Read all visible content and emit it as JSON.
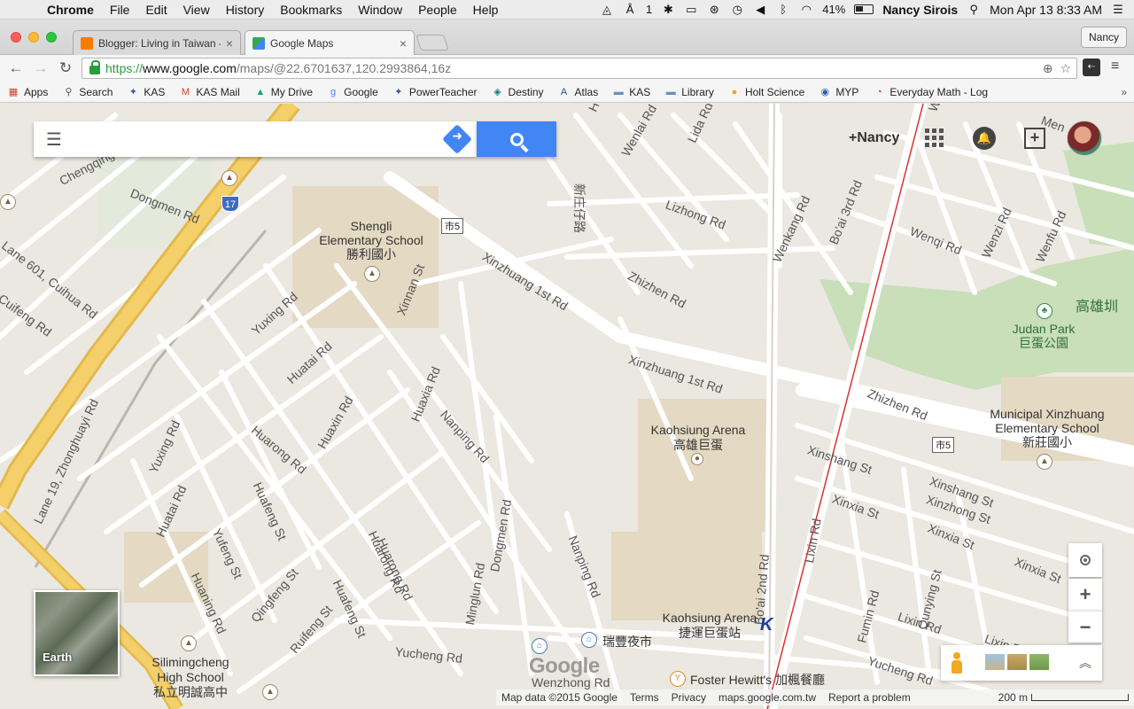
{
  "menubar": {
    "app": "Chrome",
    "items": [
      "File",
      "Edit",
      "View",
      "History",
      "Bookmarks",
      "Window",
      "People",
      "Help"
    ],
    "adobe_badge": "1",
    "battery": "41%",
    "user": "Nancy Sirois",
    "clock": "Mon Apr 13  8:33 AM"
  },
  "tabs": [
    {
      "title": "Blogger: Living in Taiwan -",
      "favicon_color": "#f57d00"
    },
    {
      "title": "Google Maps",
      "favicon_color": "#34a853"
    }
  ],
  "profile": "Nancy",
  "address": {
    "scheme": "https://",
    "host": "www.google.com",
    "path": "/maps/@22.6701637,120.2993864,16z"
  },
  "bookmarks": [
    {
      "label": "Apps",
      "icon": "apps-grid-icon",
      "glyph": "▦",
      "color": "#d23f31"
    },
    {
      "label": "Search",
      "icon": "search-icon",
      "glyph": "⚲",
      "color": "#555"
    },
    {
      "label": "KAS",
      "icon": "kas-icon",
      "glyph": "✦",
      "color": "#3b5998"
    },
    {
      "label": "KAS Mail",
      "icon": "gmail-icon",
      "glyph": "M",
      "color": "#d23f31"
    },
    {
      "label": "My Drive",
      "icon": "drive-icon",
      "glyph": "▲",
      "color": "#1fa463"
    },
    {
      "label": "Google",
      "icon": "google-icon",
      "glyph": "g",
      "color": "#4285f4"
    },
    {
      "label": "PowerTeacher",
      "icon": "powerteacher-icon",
      "glyph": "✦",
      "color": "#3b5998"
    },
    {
      "label": "Destiny",
      "icon": "destiny-icon",
      "glyph": "◈",
      "color": "#0a7e6e"
    },
    {
      "label": "Atlas",
      "icon": "atlas-icon",
      "glyph": "A",
      "color": "#2b4c7e"
    },
    {
      "label": "KAS",
      "icon": "folder-icon",
      "glyph": "▬",
      "color": "#6a8fbf"
    },
    {
      "label": "Library",
      "icon": "folder-icon",
      "glyph": "▬",
      "color": "#6a8fbf"
    },
    {
      "label": "Holt Science",
      "icon": "holt-icon",
      "glyph": "●",
      "color": "#f0a030"
    },
    {
      "label": "MYP",
      "icon": "myp-icon",
      "glyph": "◉",
      "color": "#2d5fa8"
    },
    {
      "label": "Everyday Math - Log",
      "icon": "everyday-math-icon",
      "glyph": "◔",
      "color": "#c33"
    }
  ],
  "bookmarks_more": "»",
  "search": {
    "placeholder": "",
    "value": ""
  },
  "account": {
    "name": "+Nancy"
  },
  "map": {
    "street_labels": [
      {
        "text": "Chengqing Rd"
      },
      {
        "text": "Dongmen Rd"
      },
      {
        "text": "Lane 601, Cuihua Rd"
      },
      {
        "text": "Cuifeng Rd"
      },
      {
        "text": "Yuxing Rd"
      },
      {
        "text": "Huatai Rd"
      },
      {
        "text": "Huarong Rd"
      },
      {
        "text": "Huaxin Rd"
      },
      {
        "text": "Huaxia Rd"
      },
      {
        "text": "Nanping Rd"
      },
      {
        "text": "Xinnan St"
      },
      {
        "text": "Xinzhuang 1st Rd"
      },
      {
        "text": "Xinzhuang 1st Rd"
      },
      {
        "text": "Zhizhen Rd"
      },
      {
        "text": "Lizhong Rd"
      },
      {
        "text": "Wenlai Rd"
      },
      {
        "text": "Lida Rd"
      },
      {
        "text": "Wenkang Rd"
      },
      {
        "text": "Bo'ai 3rd Rd"
      },
      {
        "text": "Wenqi Rd"
      },
      {
        "text": "Wenzi Rd"
      },
      {
        "text": "Wenfu Rd"
      },
      {
        "text": "Zhizhen Rd"
      },
      {
        "text": "Xinshang St"
      },
      {
        "text": "Xinxia St"
      },
      {
        "text": "Xinzhong St"
      },
      {
        "text": "Xinshang St"
      },
      {
        "text": "Xinxia St"
      },
      {
        "text": "Xinxia St"
      },
      {
        "text": "Lixin Rd"
      },
      {
        "text": "Bo'ai 2nd Rd"
      },
      {
        "text": "Fumin Rd"
      },
      {
        "text": "Qunying St"
      },
      {
        "text": "Lixin Rd"
      },
      {
        "text": "Lixin Rd"
      },
      {
        "text": "Yucheng Rd"
      },
      {
        "text": "Yucheng Rd"
      },
      {
        "text": "Wenzhong Rd"
      },
      {
        "text": "Minglun Rd"
      },
      {
        "text": "Dongmen Rd"
      },
      {
        "text": "Nanping Rd"
      },
      {
        "text": "Huarong Rd"
      },
      {
        "text": "Huafeng St"
      },
      {
        "text": "Huafeng St"
      },
      {
        "text": "Qingfeng St"
      },
      {
        "text": "Ruifeng St"
      },
      {
        "text": "Yufeng St"
      },
      {
        "text": "Huaning Rd"
      },
      {
        "text": "Huatai Rd"
      },
      {
        "text": "Yuxing Rd"
      },
      {
        "text": "Lane 19, Zhonghuayi Rd"
      },
      {
        "text": "Huarong Rd"
      },
      {
        "text": "新庄仔路"
      },
      {
        "text": "Hua"
      },
      {
        "text": "Wen"
      },
      {
        "text": "Men"
      }
    ],
    "place_labels": {
      "shengli": "Shengli Elementary School",
      "shengli_zh": "勝利國小",
      "arena": "Kaohsiung Arena",
      "arena_zh": "高雄巨蛋",
      "judan_park": "Judan Park",
      "judan_park_zh": "巨蛋公園",
      "kaohsiung_zh": "高雄圳",
      "xinzhuang_school": "Municipal Xinzhuang Elementary School",
      "xinzhuang_school_zh": "新莊國小",
      "mrt": "Kaohsiung Arena",
      "mrt_zh": "捷運巨蛋站",
      "night_market": "瑞豐夜市",
      "foster": "Foster Hewitt's",
      "foster_zh": "加楓餐廳",
      "silimingcheng": "Silimingcheng High School",
      "silimingcheng_zh": "私立明誠高中"
    },
    "route_shields": {
      "city5": "市5",
      "city5b": "市5",
      "hwy17": "17"
    },
    "earth_label": "Earth",
    "logo": "Google"
  },
  "controls": {
    "zoom_in": "+",
    "zoom_out": "−",
    "expand": "︽"
  },
  "footer": {
    "map_data": "Map data ©2015 Google",
    "terms": "Terms",
    "privacy": "Privacy",
    "domain": "maps.google.com.tw",
    "report": "Report a problem",
    "scale": "200 m"
  },
  "colors": {
    "map_bg": "#ebe8e1",
    "road": "#ffffff",
    "highway": "#f4cf6a",
    "park": "#c8dfb9",
    "accent_blue": "#4285f4",
    "mrt_line": "#e03030"
  }
}
